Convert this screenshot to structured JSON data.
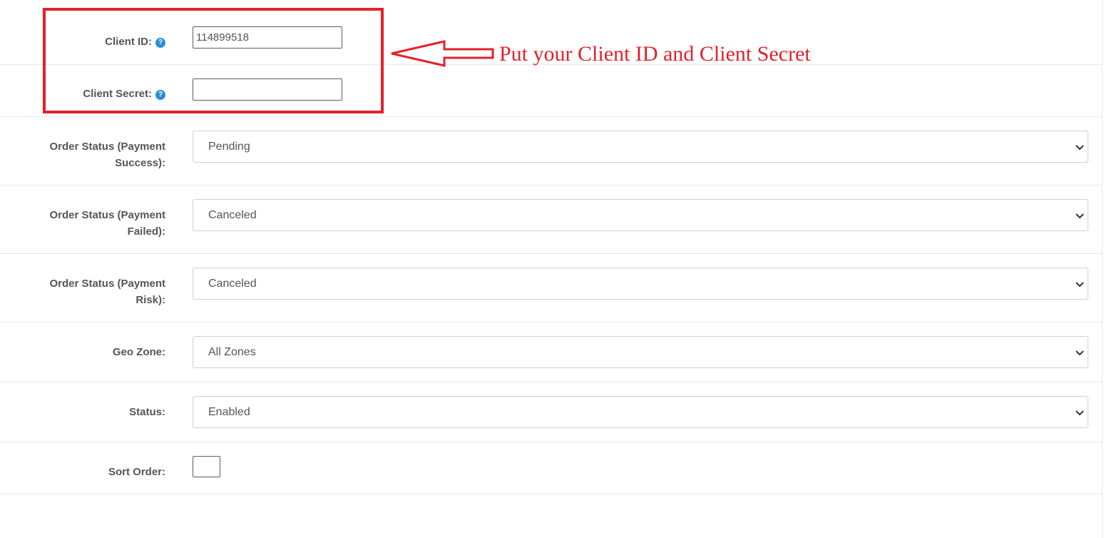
{
  "fields": {
    "client_id": {
      "label": "Client ID:",
      "value": "114899518"
    },
    "client_secret": {
      "label": "Client Secret:",
      "value": ""
    },
    "order_status_success": {
      "label_line1": "Order Status (Payment",
      "label_line2": "Success):",
      "selected": "Pending"
    },
    "order_status_failed": {
      "label_line1": "Order Status (Payment",
      "label_line2": "Failed):",
      "selected": "Canceled"
    },
    "order_status_risk": {
      "label_line1": "Order Status (Payment",
      "label_line2": "Risk):",
      "selected": "Canceled"
    },
    "geo_zone": {
      "label": "Geo Zone:",
      "selected": "All Zones"
    },
    "status": {
      "label": "Status:",
      "selected": "Enabled"
    },
    "sort_order": {
      "label": "Sort Order:",
      "value": ""
    }
  },
  "help_icon_glyph": "?",
  "annotation": {
    "text": "Put your Client ID and Client Secret",
    "color": "#e32129"
  },
  "colors": {
    "help_icon": "#2a8fd6",
    "highlight": "#e32129",
    "label": "#555555"
  }
}
